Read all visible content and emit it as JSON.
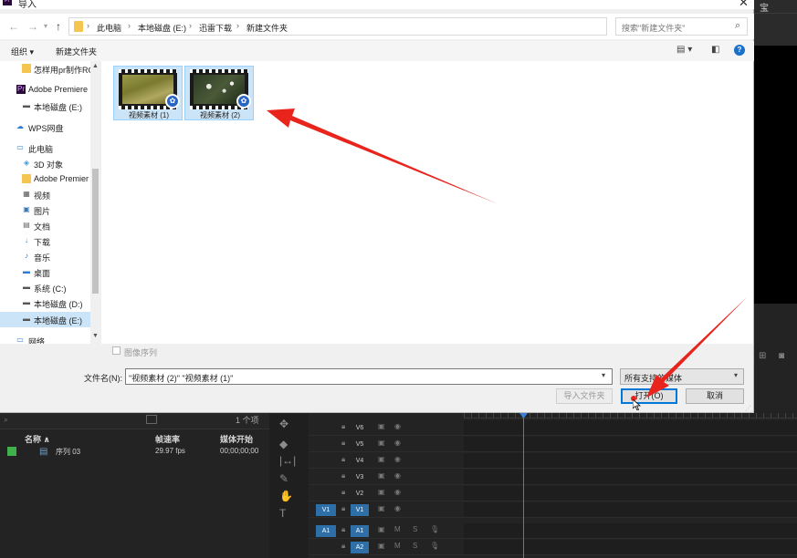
{
  "dialog": {
    "title": "导入",
    "app_icon": "Pr",
    "address": {
      "crumbs": [
        "此电脑",
        "本地磁盘 (E:)",
        "迅雷下载",
        "新建文件夹"
      ],
      "search_placeholder": "搜索\"新建文件夹\""
    },
    "toolbar": {
      "organize": "组织 ▾",
      "new_folder": "新建文件夹"
    },
    "nav_items": [
      {
        "label": "怎样用pr制作RC",
        "icon": "folder-icon"
      },
      {
        "label": "Adobe Premiere",
        "icon": "premiere-icon"
      },
      {
        "label": "本地磁盘 (E:)",
        "icon": "drive-icon"
      },
      {
        "label": "WPS网盘",
        "icon": "cloud-icon"
      },
      {
        "label": "此电脑",
        "icon": "computer-icon"
      },
      {
        "label": "3D 对象",
        "icon": "3d-objects-icon"
      },
      {
        "label": "Adobe Premier",
        "icon": "folder-icon"
      },
      {
        "label": "视频",
        "icon": "video-icon"
      },
      {
        "label": "图片",
        "icon": "pictures-icon"
      },
      {
        "label": "文档",
        "icon": "documents-icon"
      },
      {
        "label": "下载",
        "icon": "download-icon"
      },
      {
        "label": "音乐",
        "icon": "music-icon"
      },
      {
        "label": "桌面",
        "icon": "desktop-icon"
      },
      {
        "label": "系统 (C:)",
        "icon": "system-drive-icon"
      },
      {
        "label": "本地磁盘 (D:)",
        "icon": "drive-icon"
      },
      {
        "label": "本地磁盘 (E:)",
        "icon": "drive-icon"
      },
      {
        "label": "网络",
        "icon": "network-icon"
      }
    ],
    "files": [
      {
        "name": "视频素材 (1)",
        "selected": true
      },
      {
        "name": "视频素材 (2)",
        "selected": true
      }
    ],
    "image_sequence_label": "图像序列",
    "filename_label": "文件名(N):",
    "filename_value": "\"视频素材 (2)\" \"视频素材 (1)\"",
    "filetype_value": "所有支持的媒体",
    "buttons": {
      "import_folder": "导入文件夹",
      "open": "打开(O)",
      "cancel": "取消"
    }
  },
  "premiere": {
    "top_right_tab": "宝",
    "project": {
      "item_count": "1 个项",
      "columns": [
        "名称 ∧",
        "帧速率",
        "媒体开始"
      ],
      "row": {
        "name": "序列 03",
        "fps": "29.97 fps",
        "start": "00;00;00;00"
      }
    },
    "tracks": {
      "video": [
        "V6",
        "V5",
        "V4",
        "V3",
        "V2",
        "V1"
      ],
      "audio": [
        "A1",
        "A2"
      ],
      "source_video": "V1",
      "source_audio": "A1"
    }
  },
  "colors": {
    "selection": "#cce4f7",
    "accent": "#0078d7",
    "annotation_red": "#e8241c",
    "pr_blue": "#2f6fa8"
  }
}
